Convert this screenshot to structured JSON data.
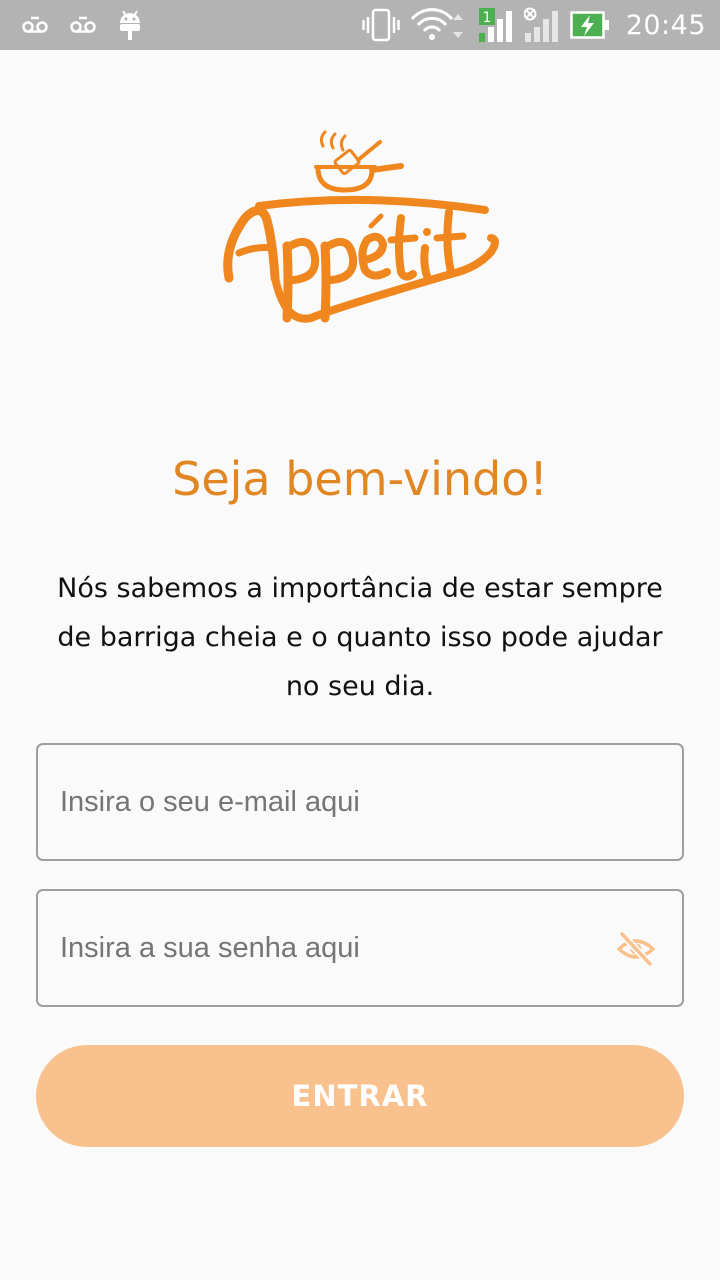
{
  "status_bar": {
    "time": "20:45",
    "sim_slot": "1",
    "icons": [
      "voicemail-icon",
      "voicemail-icon",
      "android-debug-icon",
      "vibrate-icon",
      "wifi-icon",
      "signal-sim1-icon",
      "signal-sim2-no-service-icon",
      "battery-charging-icon"
    ]
  },
  "brand": {
    "logo_text": "Appetit",
    "accent_color": "#f0871e"
  },
  "welcome": {
    "title": "Seja bem-vindo!",
    "description": "Nós sabemos a importância de estar sempre de barriga cheia e o quanto isso pode ajudar no seu dia."
  },
  "form": {
    "email_placeholder": "Insira o seu e-mail aqui",
    "password_placeholder": "Insira a sua senha aqui",
    "password_toggle_icon": "visibility-off-icon",
    "submit_label": "ENTRAR",
    "button_color": "#f9c18d"
  }
}
